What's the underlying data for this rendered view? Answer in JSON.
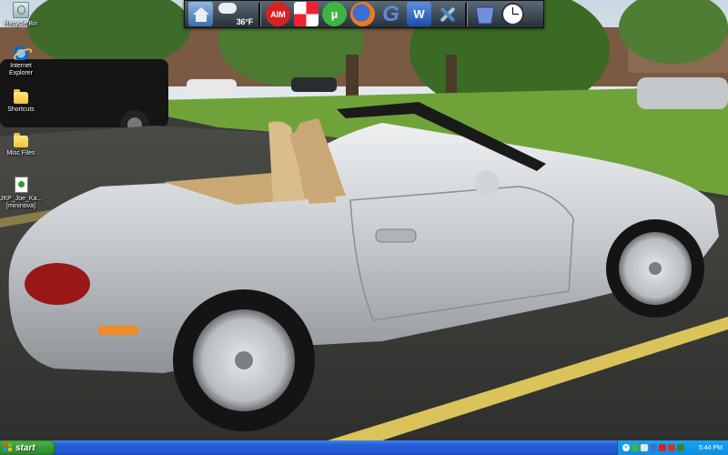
{
  "desktop": {
    "icons": [
      {
        "label": "Recycle Bin",
        "icon": "recycle-bin-icon"
      },
      {
        "label": "Internet Explorer",
        "icon": "internet-explorer-icon"
      },
      {
        "label": "Shortcuts",
        "icon": "folder-icon"
      },
      {
        "label": "Misc Files",
        "icon": "folder-icon"
      },
      {
        "label": "JKP_Joe_Ka... [mininova]",
        "icon": "torrent-file-icon"
      }
    ]
  },
  "dock": {
    "weather_temp": "36°F",
    "items": [
      {
        "icon": "home-icon"
      },
      {
        "icon": "weather-icon"
      },
      {
        "icon": "aim-icon",
        "text": "AIM"
      },
      {
        "icon": "shield-icon"
      },
      {
        "icon": "utorrent-icon",
        "text": "µ"
      },
      {
        "icon": "firefox-icon"
      },
      {
        "icon": "google-icon",
        "text": "G"
      },
      {
        "icon": "word-icon",
        "text": "W"
      },
      {
        "icon": "tools-icon"
      },
      {
        "icon": "recycle-bin-icon"
      },
      {
        "icon": "clock-icon"
      }
    ]
  },
  "taskbar": {
    "start_label": "start",
    "clock": "5:44 PM",
    "tray_expand": "«"
  },
  "colors": {
    "taskbar_blue": "#245edb",
    "start_green": "#3a9b3a",
    "tray_blue": "#0e8ee0"
  }
}
